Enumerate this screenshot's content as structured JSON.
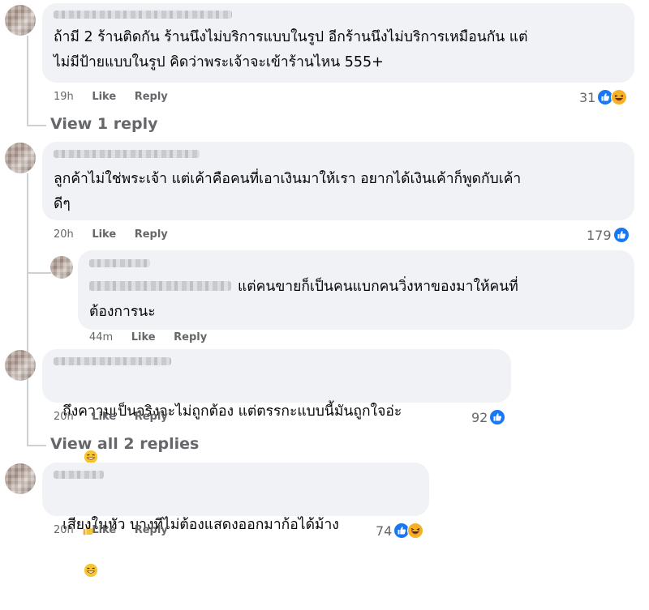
{
  "comments": [
    {
      "text_line1": "ถ้ามี 2 ร้านติดกัน ร้านนึงไม่บริการแบบในรูป อีกร้านนึงไม่บริการเหมือนกัน แต่",
      "text_line2": "ไม่มีป้ายแบบในรูป คิดว่าพระเจ้าจะเข้าร้านไหน 555+",
      "time": "19h",
      "like": "Like",
      "reply": "Reply",
      "reaction_count": "31",
      "reaction_icons": [
        "like-icon",
        "haha-icon"
      ]
    },
    {
      "text_line1": "ลูกค้าไม่ใช่พระเจ้า แต่เค้าคือคนที่เอาเงินมาให้เรา อยากได้เงินเค้าก็พูดกับเค้า",
      "text_line2": "ดีๆ",
      "time": "20h",
      "like": "Like",
      "reply": "Reply",
      "reaction_count": "179",
      "reaction_icons": [
        "like-icon"
      ]
    },
    {
      "text_line1": "แต่คนขายก็เป็นคนแบกคนวิ่งหาของมาให้คนที่",
      "text_line2": "ต้องการนะ",
      "time": "44m",
      "like": "Like",
      "reply": "Reply"
    },
    {
      "text_line1": "ถึงความเป็นจริงจะไม่ถูกต้อง แต่ตรรกะแบบนี้มันถูกใจอ่ะ",
      "inline_emojis": [
        "grin-emoji",
        "thumbs-up-emoji"
      ],
      "time": "20h",
      "like": "Like",
      "reply": "Reply",
      "reaction_count": "92",
      "reaction_icons": [
        "like-icon"
      ]
    },
    {
      "text_line1": "เสียงในหัว บางทีไม่ต้องแสดงออกมาก้อได้ม้าง",
      "inline_emojis": [
        "grin-emoji"
      ],
      "time": "20h",
      "like": "Like",
      "reply": "Reply",
      "reaction_count": "74",
      "reaction_icons": [
        "like-icon",
        "haha-icon"
      ]
    }
  ],
  "view_replies": [
    "View 1 reply",
    "View all 2 replies"
  ],
  "colors": {
    "bubble": "#f0f2f5",
    "meta_text": "#65676b",
    "like_blue": "#1877f2",
    "haha_yellow": "#f7b125"
  }
}
